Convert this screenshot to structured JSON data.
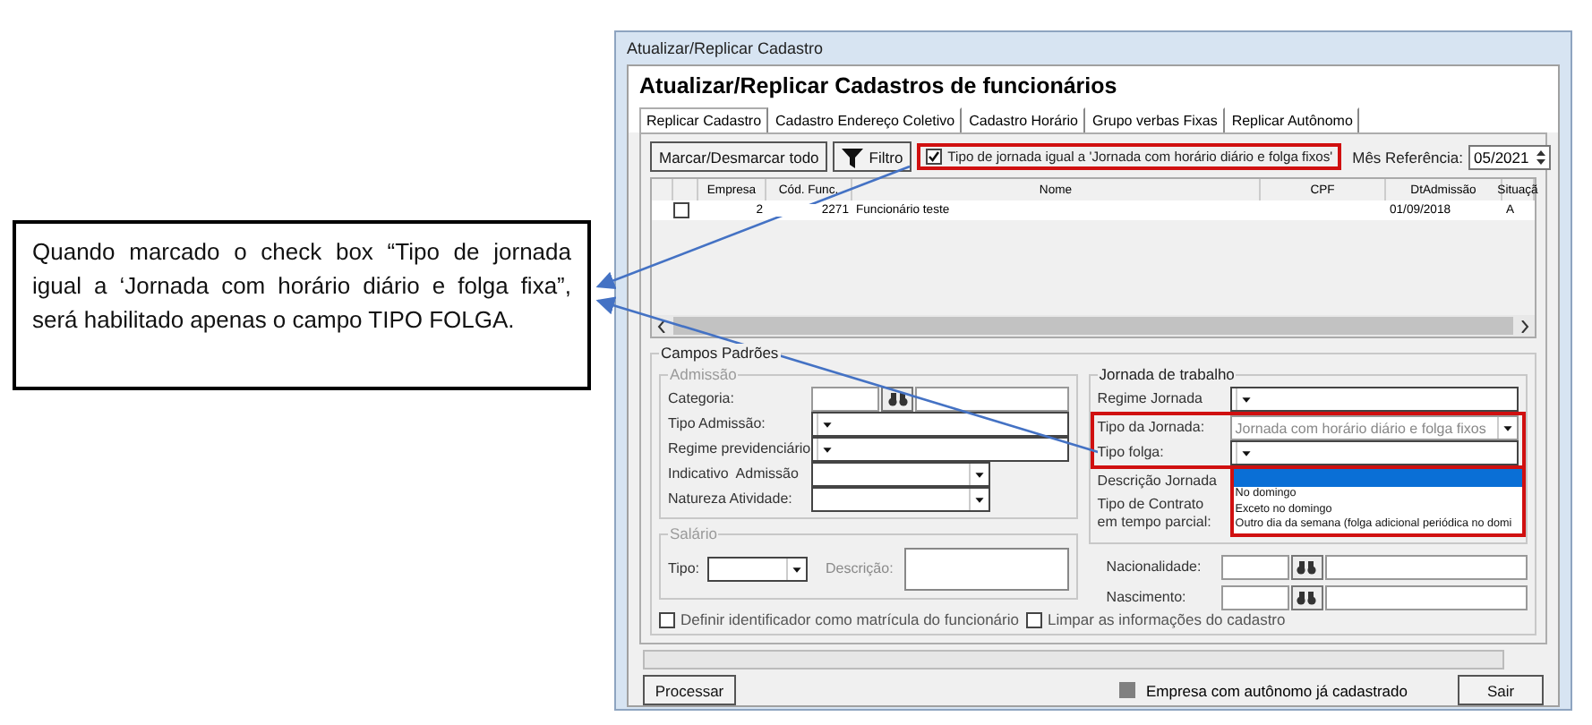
{
  "callout": {
    "text": "Quando marcado o check box “Tipo de jornada igual a ‘Jornada com horário diário e folga fixa”, será habilitado apenas o campo TIPO FOLGA."
  },
  "window": {
    "title": "Atualizar/Replicar Cadastro"
  },
  "heading": "Atualizar/Replicar Cadastros de funcionários",
  "tabs": [
    {
      "label": "Replicar Cadastro",
      "selected": true
    },
    {
      "label": "Cadastro Endereço Coletivo",
      "selected": false
    },
    {
      "label": "Cadastro Horário",
      "selected": false
    },
    {
      "label": "Grupo verbas Fixas",
      "selected": false
    },
    {
      "label": "Replicar Autônomo",
      "selected": false
    }
  ],
  "toolbar": {
    "select_all_button": "Marcar/Desmarcar todo",
    "filter_button": "Filtro",
    "jornada_checkbox": {
      "label": "Tipo de jornada igual a 'Jornada com horário diário e folga fixos'",
      "checked": true,
      "highlighted": true
    },
    "reference_month": {
      "label": "Mês Referência:",
      "value": "05/2021"
    }
  },
  "table": {
    "columns": [
      "Empresa",
      "Cód. Func.",
      "Nome",
      "CPF",
      "DtAdmissão",
      "Situaçã"
    ],
    "rows": [
      {
        "checked": false,
        "cells": [
          "2",
          "2271",
          "Funcionário teste",
          null,
          "01/09/2018",
          "A"
        ]
      }
    ]
  },
  "campos_padroes": {
    "title": "Campos Padrões",
    "admissao": {
      "title": "Admissão",
      "disabled": true,
      "fields": [
        {
          "label": "Categoria:",
          "kind": "lookup"
        },
        {
          "label": "Tipo Admissão:",
          "kind": "combo"
        },
        {
          "label": "Regime previdenciário",
          "kind": "combo"
        },
        {
          "label": "Indicativo  Admissão",
          "kind": "short_combo"
        },
        {
          "label": "Natureza Atividade:",
          "kind": "short_combo"
        }
      ]
    },
    "salario": {
      "title": "Salário",
      "disabled": true,
      "tipo_label": "Tipo:",
      "descricao_label": "Descrição:"
    },
    "jornada": {
      "title": "Jornada de trabalho",
      "fields": [
        {
          "label": "Regime Jornada",
          "kind": "combo",
          "highlighted": false
        },
        {
          "label": "Tipo da Jornada:",
          "kind": "combo",
          "value": "Jornada com horário diário e folga fixos",
          "disabled": true,
          "highlighted": true
        },
        {
          "label": "Tipo folga:",
          "kind": "combo",
          "highlighted": true,
          "expanded": true,
          "options": [
            {
              "selected": true
            },
            {
              "label": "No domingo",
              "selected": false
            },
            {
              "label": "Exceto no domingo",
              "selected": false
            },
            {
              "label": "Outro dia da semana (folga adicional periódica no domi",
              "selected": false
            }
          ]
        },
        {
          "label": "Descrição Jornada",
          "kind": "covered",
          "highlighted": false
        },
        {
          "label": "Tipo de Contrato\nem tempo parcial:",
          "kind": "covered",
          "highlighted": false
        }
      ]
    },
    "extra_fields": [
      {
        "label": "Nacionalidade:",
        "kind": "lookup"
      },
      {
        "label": "Nascimento:",
        "kind": "lookup"
      }
    ],
    "options": [
      {
        "label": "Definir identificador como matrícula do funcionário",
        "checked": false
      },
      {
        "label": "Limpar as informações do cadastro",
        "checked": false
      }
    ]
  },
  "progress": {
    "level": 0
  },
  "footer": {
    "process_button": "Processar",
    "legend": {
      "label": "Empresa com autônomo já cadastrado",
      "color": "#808080"
    },
    "exit_button": "Sair"
  }
}
